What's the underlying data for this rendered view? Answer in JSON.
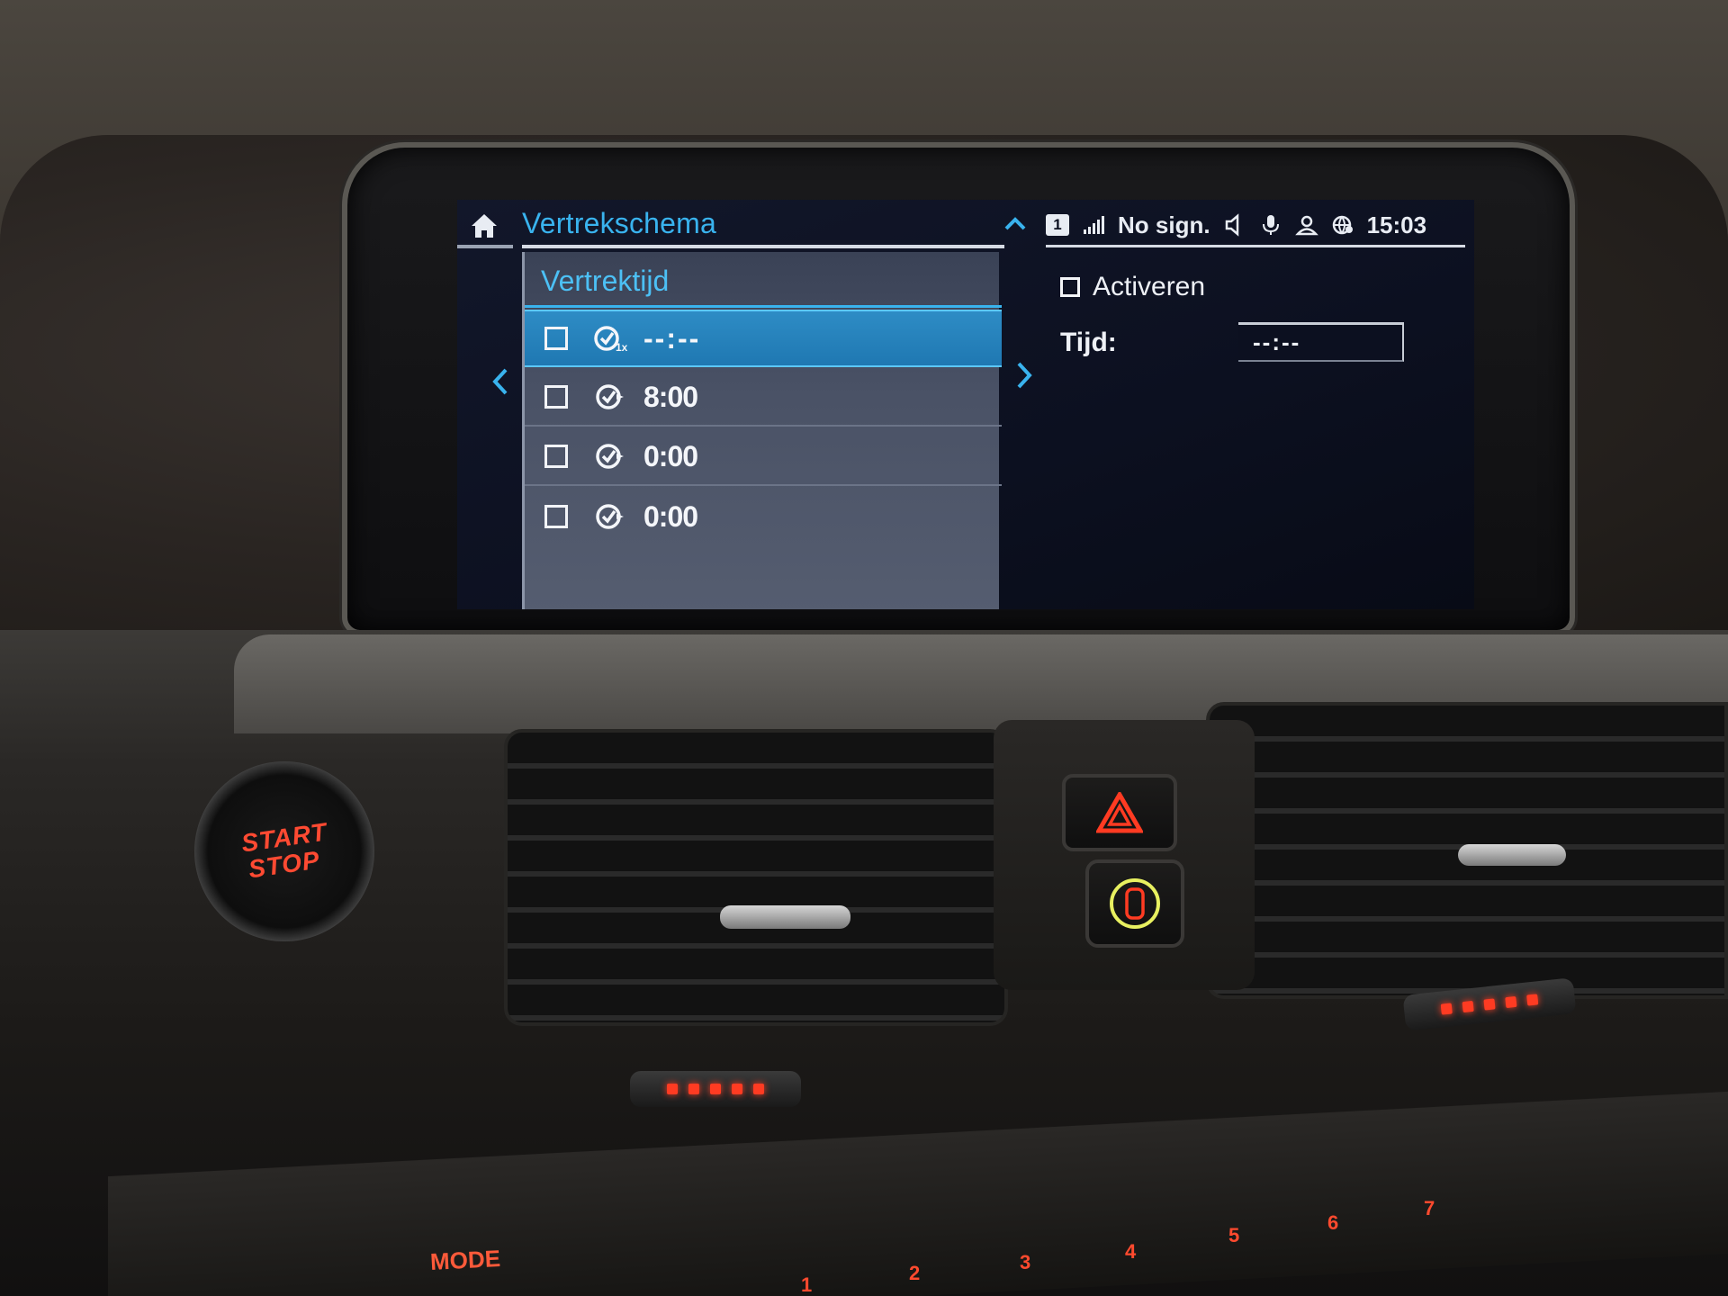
{
  "screen": {
    "title": "Vertrekschema",
    "status": {
      "sim_slot": "1",
      "signal_text": "No sign.",
      "clock": "15:03",
      "icons": [
        "signal-bars-icon",
        "speaker-muted-icon",
        "microphone-icon",
        "user-profile-icon",
        "connected-services-icon"
      ]
    },
    "list": {
      "header": "Vertrektijd",
      "rows": [
        {
          "time": "--:--",
          "icon": "timer-once-icon",
          "once_badge": "1x",
          "checked": false,
          "selected": true
        },
        {
          "time": "8:00",
          "icon": "timer-icon",
          "checked": false,
          "selected": false
        },
        {
          "time": "0:00",
          "icon": "timer-icon",
          "checked": false,
          "selected": false
        },
        {
          "time": "0:00",
          "icon": "timer-icon",
          "checked": false,
          "selected": false
        }
      ]
    },
    "detail": {
      "activate_label": "Activeren",
      "time_label": "Tijd:",
      "time_value": "--:--"
    },
    "colors": {
      "accent": "#39b3ee",
      "selected_row": "#2482bd",
      "text": "#eef1f6",
      "list_bg": "#4a5266"
    }
  },
  "dashboard": {
    "start_stop": [
      "START",
      "STOP"
    ],
    "mode_label": "MODE",
    "presets": [
      "1",
      "2",
      "3",
      "4",
      "5",
      "6",
      "7"
    ]
  }
}
